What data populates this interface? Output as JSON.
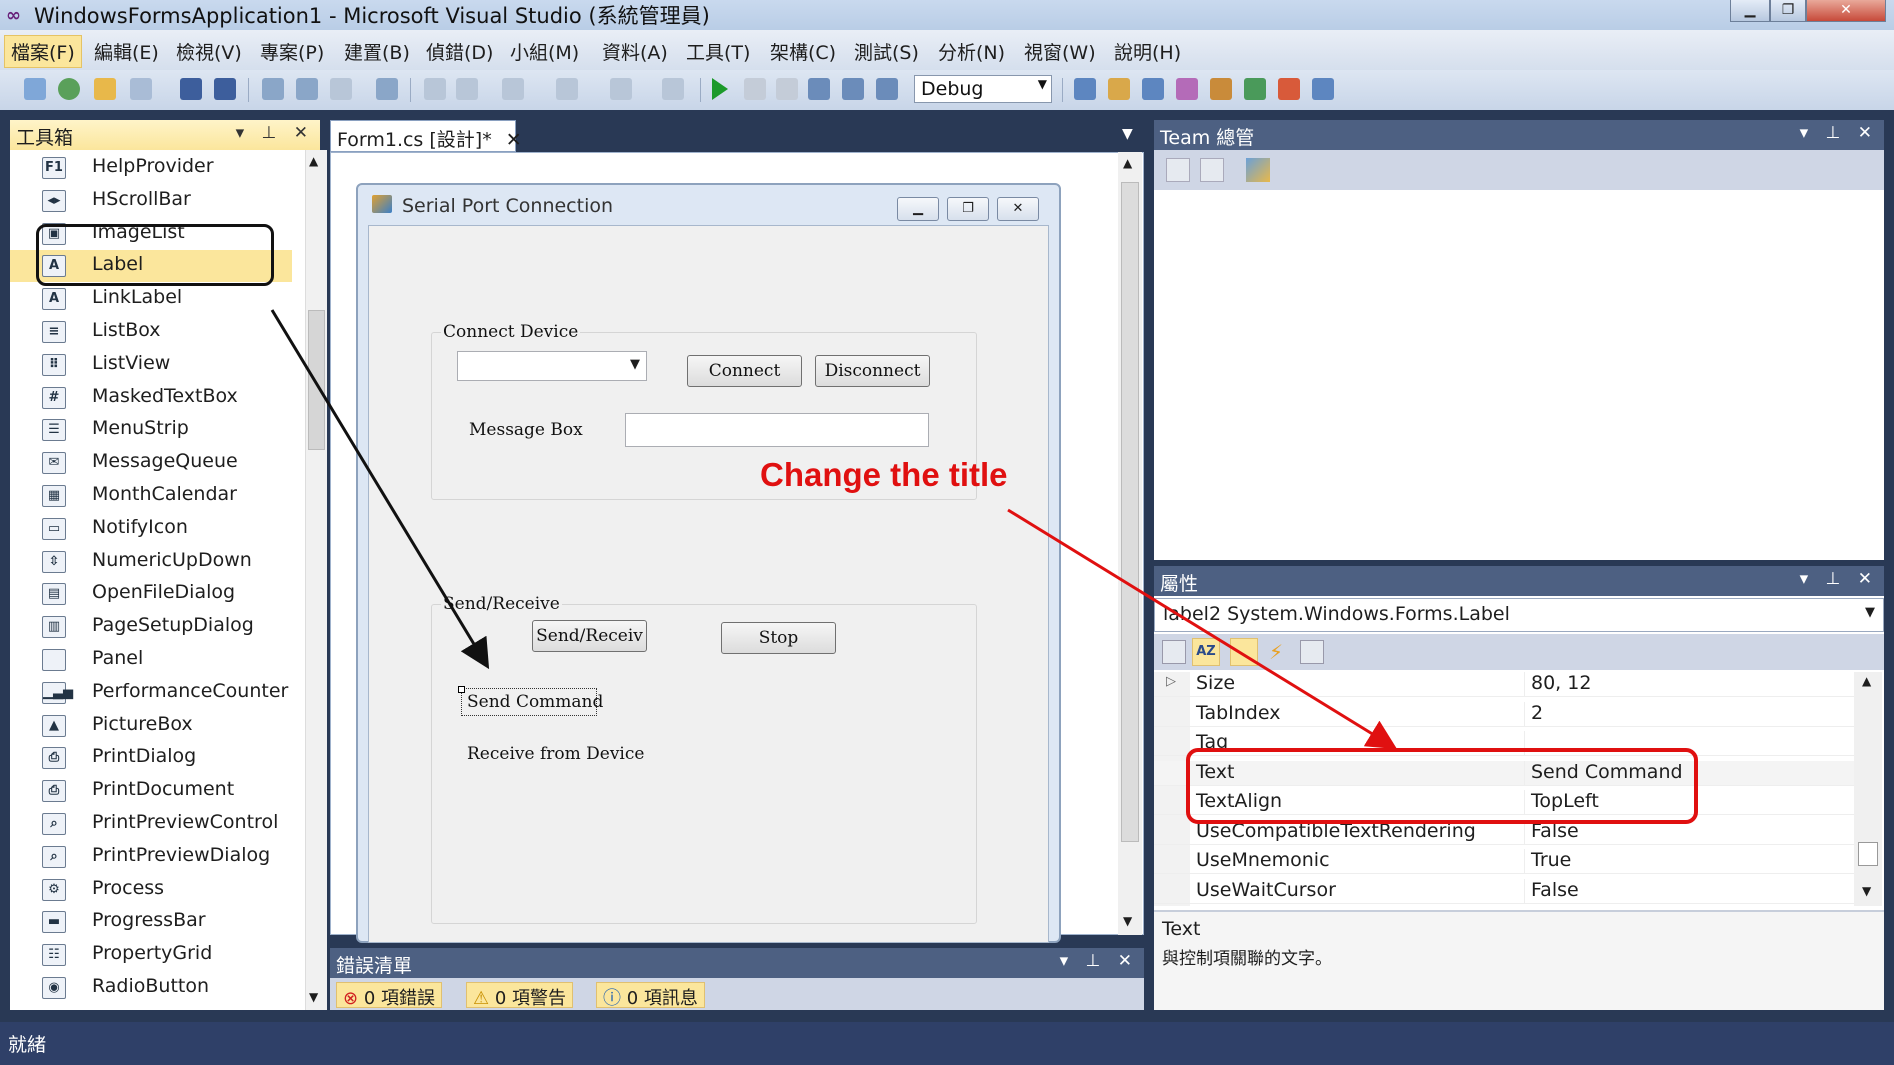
{
  "window": {
    "title": "WindowsFormsApplication1 - Microsoft Visual Studio (系統管理員)",
    "icon": "vs-logo-icon"
  },
  "menu": [
    "檔案(F)",
    "編輯(E)",
    "檢視(V)",
    "專案(P)",
    "建置(B)",
    "偵錯(D)",
    "小組(M)",
    "資料(A)",
    "工具(T)",
    "架構(C)",
    "測試(S)",
    "分析(N)",
    "視窗(W)",
    "說明(H)"
  ],
  "toolbar": {
    "config": "Debug"
  },
  "toolbox": {
    "title": "工具箱",
    "items": [
      {
        "label": "HelpProvider",
        "icon": "help-icon",
        "glyph": "F1"
      },
      {
        "label": "HScrollBar",
        "icon": "hscrollbar-icon",
        "glyph": "◂▸"
      },
      {
        "label": "ImageList",
        "icon": "imagelist-icon",
        "glyph": "▣"
      },
      {
        "label": "Label",
        "icon": "label-icon",
        "glyph": "A"
      },
      {
        "label": "LinkLabel",
        "icon": "linklabel-icon",
        "glyph": "A"
      },
      {
        "label": "ListBox",
        "icon": "listbox-icon",
        "glyph": "≡"
      },
      {
        "label": "ListView",
        "icon": "listview-icon",
        "glyph": "⠿"
      },
      {
        "label": "MaskedTextBox",
        "icon": "maskedtextbox-icon",
        "glyph": "#"
      },
      {
        "label": "MenuStrip",
        "icon": "menustrip-icon",
        "glyph": "☰"
      },
      {
        "label": "MessageQueue",
        "icon": "messagequeue-icon",
        "glyph": "✉"
      },
      {
        "label": "MonthCalendar",
        "icon": "calendar-icon",
        "glyph": "▦"
      },
      {
        "label": "NotifyIcon",
        "icon": "notifyicon-icon",
        "glyph": "▭"
      },
      {
        "label": "NumericUpDown",
        "icon": "numericupdown-icon",
        "glyph": "⇳"
      },
      {
        "label": "OpenFileDialog",
        "icon": "openfile-icon",
        "glyph": "▤"
      },
      {
        "label": "PageSetupDialog",
        "icon": "pagesetup-icon",
        "glyph": "▥"
      },
      {
        "label": "Panel",
        "icon": "panel-icon",
        "glyph": " "
      },
      {
        "label": "PerformanceCounter",
        "icon": "perfcounter-icon",
        "glyph": "▁▃▅"
      },
      {
        "label": "PictureBox",
        "icon": "picturebox-icon",
        "glyph": "▲"
      },
      {
        "label": "PrintDialog",
        "icon": "printdialog-icon",
        "glyph": "⎙"
      },
      {
        "label": "PrintDocument",
        "icon": "printdocument-icon",
        "glyph": "⎙"
      },
      {
        "label": "PrintPreviewControl",
        "icon": "printpreviewcontrol-icon",
        "glyph": "⌕"
      },
      {
        "label": "PrintPreviewDialog",
        "icon": "printpreviewdialog-icon",
        "glyph": "⌕"
      },
      {
        "label": "Process",
        "icon": "process-icon",
        "glyph": "⚙"
      },
      {
        "label": "ProgressBar",
        "icon": "progressbar-icon",
        "glyph": "▬"
      },
      {
        "label": "PropertyGrid",
        "icon": "propertygrid-icon",
        "glyph": "☷"
      },
      {
        "label": "RadioButton",
        "icon": "radiobutton-icon",
        "glyph": "◉"
      }
    ]
  },
  "designer": {
    "tab": "Form1.cs [設計]*",
    "form": {
      "title": "Serial Port Connection",
      "group1": "Connect Device",
      "connect": "Connect",
      "disconnect": "Disconnect",
      "message_box": "Message Box",
      "group2": "Send/Receive",
      "send_receive": "Send/Receiv",
      "stop": "Stop",
      "send_command": "Send Command",
      "receive_from_device": "Receive from Device"
    }
  },
  "team": {
    "title": "Team 總管"
  },
  "properties": {
    "title": "屬性",
    "object": "label2 System.Windows.Forms.Label",
    "rows": [
      {
        "name": "Size",
        "value": "80, 12"
      },
      {
        "name": "TabIndex",
        "value": "2"
      },
      {
        "name": "Tag",
        "value": ""
      },
      {
        "name": "Text",
        "value": "Send Command"
      },
      {
        "name": "TextAlign",
        "value": "TopLeft"
      },
      {
        "name": "UseCompatibleTextRendering",
        "value": "False"
      },
      {
        "name": "UseMnemonic",
        "value": "True"
      },
      {
        "name": "UseWaitCursor",
        "value": "False"
      }
    ],
    "desc_title": "Text",
    "desc_body": "與控制項關聯的文字。"
  },
  "errors": {
    "title": "錯誤清單",
    "errors": "0 項錯誤",
    "warnings": "0 項警告",
    "messages": "0 項訊息"
  },
  "status": "就緒",
  "annotation": "Change the title",
  "colors": {
    "annotation": "#e01010",
    "highlight": "#fbe69c",
    "panel_header": "#4d6082"
  }
}
